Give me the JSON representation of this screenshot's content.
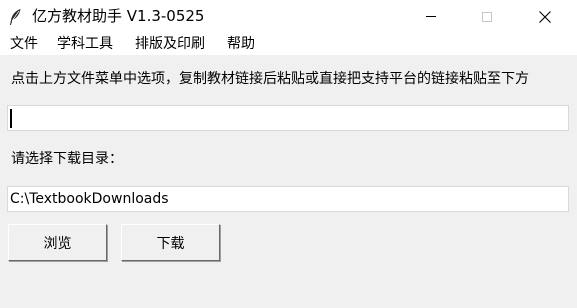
{
  "window": {
    "title": "亿方教材助手 V1.3-0525",
    "app_icon": "feather-icon",
    "controls": [
      "minimize-icon",
      "maximize-icon",
      "close-icon"
    ]
  },
  "menu": {
    "file": "文件",
    "tools": "学科工具",
    "layout_print": "排版及印刷",
    "help": "帮助"
  },
  "main": {
    "instruction": "点击上方文件菜单中选项，复制教材链接后粘贴或直接把支持平台的链接粘贴至下方",
    "link_input_value": "",
    "dir_label": "请选择下载目录：",
    "dir_value": "C:\\TextbookDownloads",
    "browse_label": "浏览",
    "download_label": "下载"
  }
}
